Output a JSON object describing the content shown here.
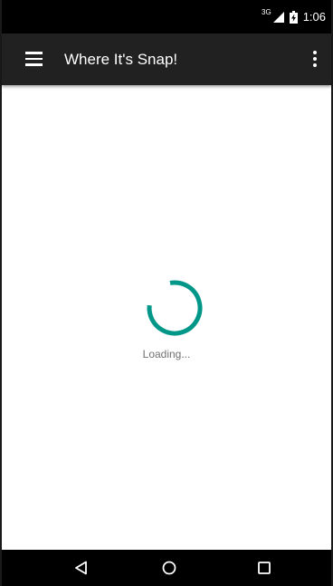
{
  "status_bar": {
    "network_type": "3G",
    "time": "1:06",
    "icons": [
      "signal-icon",
      "battery-icon"
    ]
  },
  "app_bar": {
    "menu_icon": "menu-icon",
    "title": "Where It's Snap!",
    "overflow_icon": "more-vert-icon"
  },
  "content": {
    "loading_text": "Loading...",
    "spinner_color": "#009688"
  },
  "nav_bar": {
    "icons": [
      "back-icon",
      "home-icon",
      "recents-icon"
    ]
  }
}
